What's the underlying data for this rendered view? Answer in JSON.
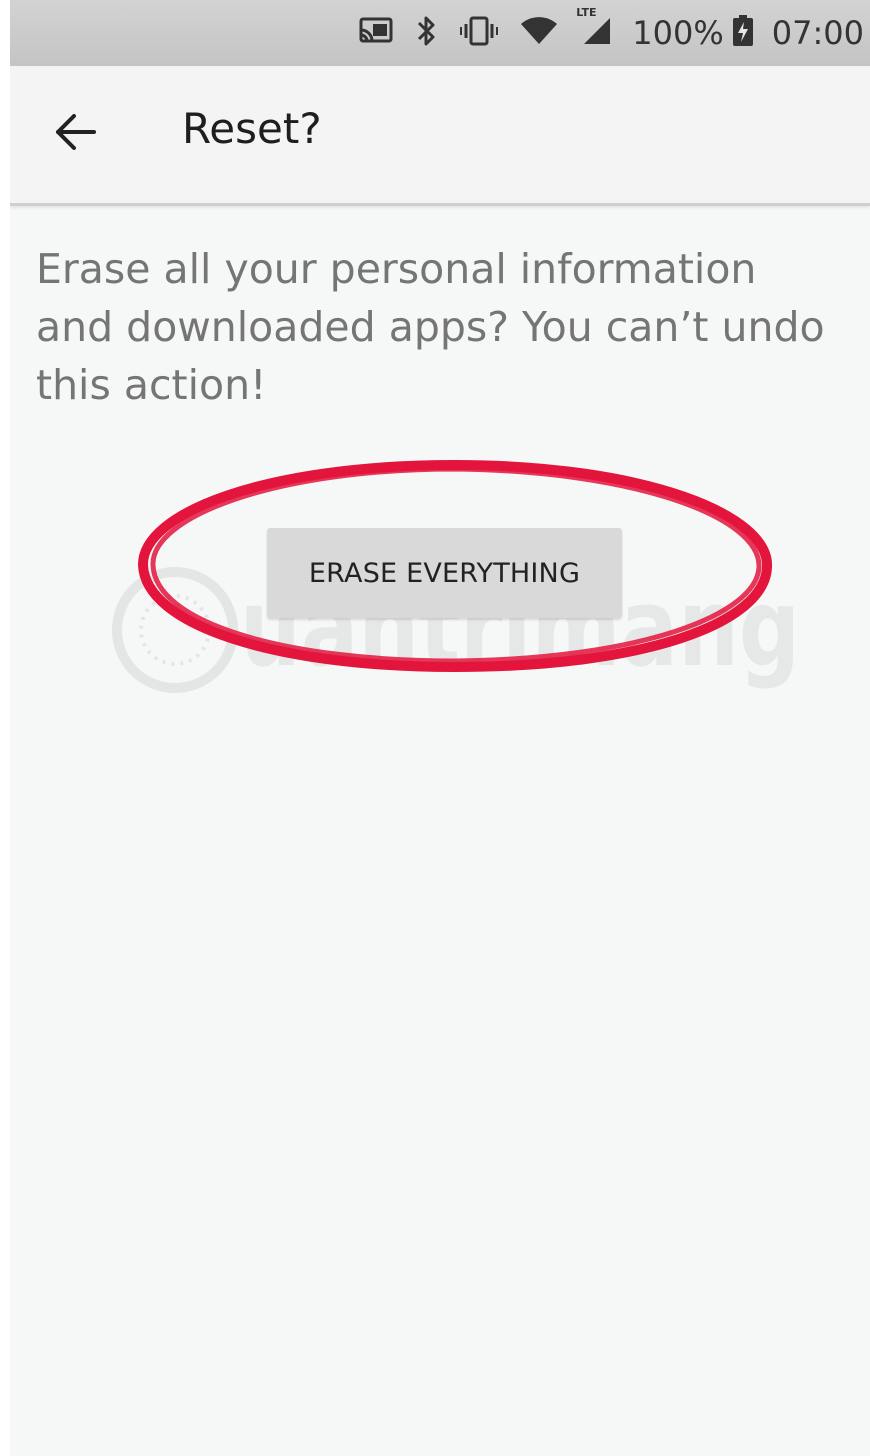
{
  "status_bar": {
    "icons": [
      "cast-icon",
      "bluetooth-icon",
      "vibrate-icon",
      "wifi-icon",
      "lte-signal-icon",
      "battery-charging-icon"
    ],
    "network_label": "LTE",
    "battery": "100%",
    "time": "07:00"
  },
  "app_bar": {
    "back_icon": "arrow-back-icon",
    "title": "Reset?"
  },
  "content": {
    "message": "Erase all your personal information and downloaded apps? You can’t undo this action!",
    "erase_button_label": "ERASE EVERYTHING"
  },
  "watermark": {
    "text": "uantrimang"
  },
  "colors": {
    "highlight_ring": "#e3153c",
    "background": "#f6f7f7",
    "button": "#d9d9d9",
    "message_text": "#757575"
  }
}
